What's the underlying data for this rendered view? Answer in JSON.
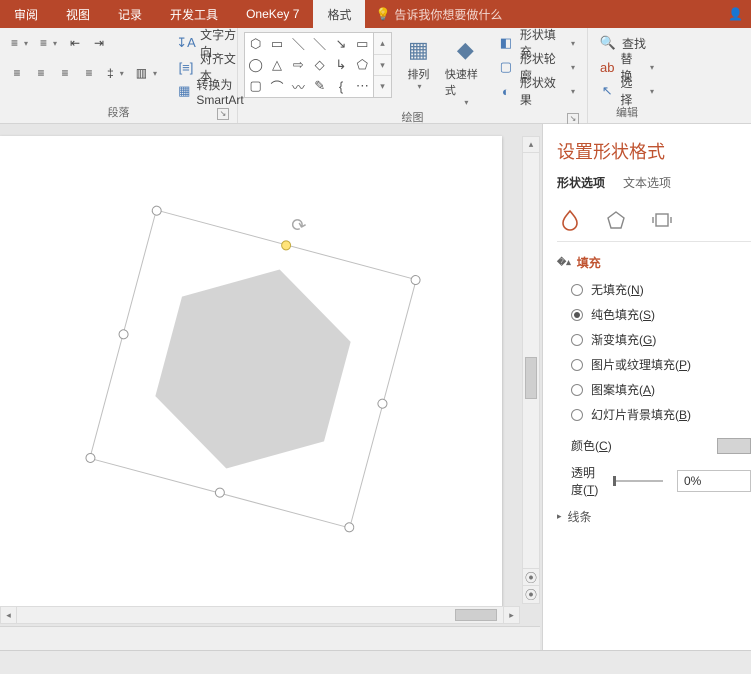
{
  "tabs": {
    "review": "审阅",
    "view": "视图",
    "record": "记录",
    "dev": "开发工具",
    "onekey": "OneKey 7",
    "format": "格式"
  },
  "tell_me": "告诉我你想要做什么",
  "ribbon": {
    "para": {
      "text_dir": "文字方向",
      "align_text": "对齐文本",
      "smartart": "转换为 SmartArt",
      "label": "段落"
    },
    "draw": {
      "arrange": "排列",
      "quick_styles": "快速样式",
      "shape_fill": "形状填充",
      "shape_outline": "形状轮廓",
      "shape_effects": "形状效果",
      "label": "绘图"
    },
    "edit": {
      "find": "查找",
      "replace": "替换",
      "select": "选择",
      "label": "编辑"
    }
  },
  "pane": {
    "title": "设置形状格式",
    "tab_shape": "形状选项",
    "tab_text": "文本选项",
    "fill": {
      "head": "填充",
      "none": "无填充",
      "none_key": "N",
      "solid": "纯色填充",
      "solid_key": "S",
      "gradient": "渐变填充",
      "gradient_key": "G",
      "picture": "图片或纹理填充",
      "picture_key": "P",
      "pattern": "图案填充",
      "pattern_key": "A",
      "slide_bg": "幻灯片背景填充",
      "slide_bg_key": "B",
      "color_label": "颜色",
      "color_key": "C",
      "trans_label": "透明度",
      "trans_key": "T",
      "trans_value": "0%"
    },
    "line_head": "线条"
  }
}
